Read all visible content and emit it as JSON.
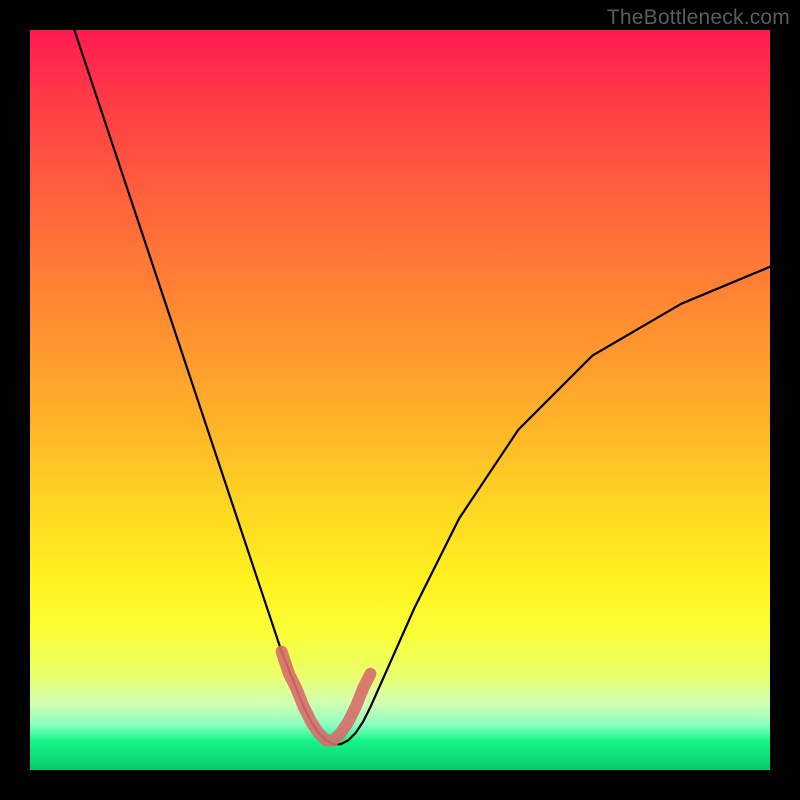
{
  "watermark": "TheBottleneck.com",
  "chart_data": {
    "type": "line",
    "title": "",
    "xlabel": "",
    "ylabel": "",
    "xlim": [
      0,
      100
    ],
    "ylim": [
      0,
      100
    ],
    "series": [
      {
        "name": "curve",
        "x": [
          6,
          10,
          14,
          18,
          22,
          26,
          30,
          32,
          34,
          36,
          37,
          38,
          39,
          40,
          41,
          42,
          43,
          44,
          45,
          46,
          48,
          52,
          58,
          66,
          76,
          88,
          100
        ],
        "values": [
          100,
          88,
          76,
          64,
          52,
          40,
          28,
          22,
          16,
          11,
          8.5,
          6.5,
          5,
          4,
          3.5,
          3.5,
          4,
          5,
          6.5,
          8.5,
          13,
          22,
          34,
          46,
          56,
          63,
          68
        ]
      }
    ],
    "highlight": {
      "name": "bottom-highlight",
      "color": "#d86b6b",
      "x": [
        34,
        35,
        36,
        37,
        38,
        39,
        40,
        41,
        42,
        43,
        44,
        45,
        46
      ],
      "values": [
        16,
        13,
        11,
        8.5,
        6.5,
        5,
        4,
        4,
        5,
        6.5,
        8.5,
        11,
        13
      ]
    },
    "background_gradient": {
      "top": "#ff1a52",
      "mid": "#fff31f",
      "bottom": "#09c96f"
    }
  }
}
